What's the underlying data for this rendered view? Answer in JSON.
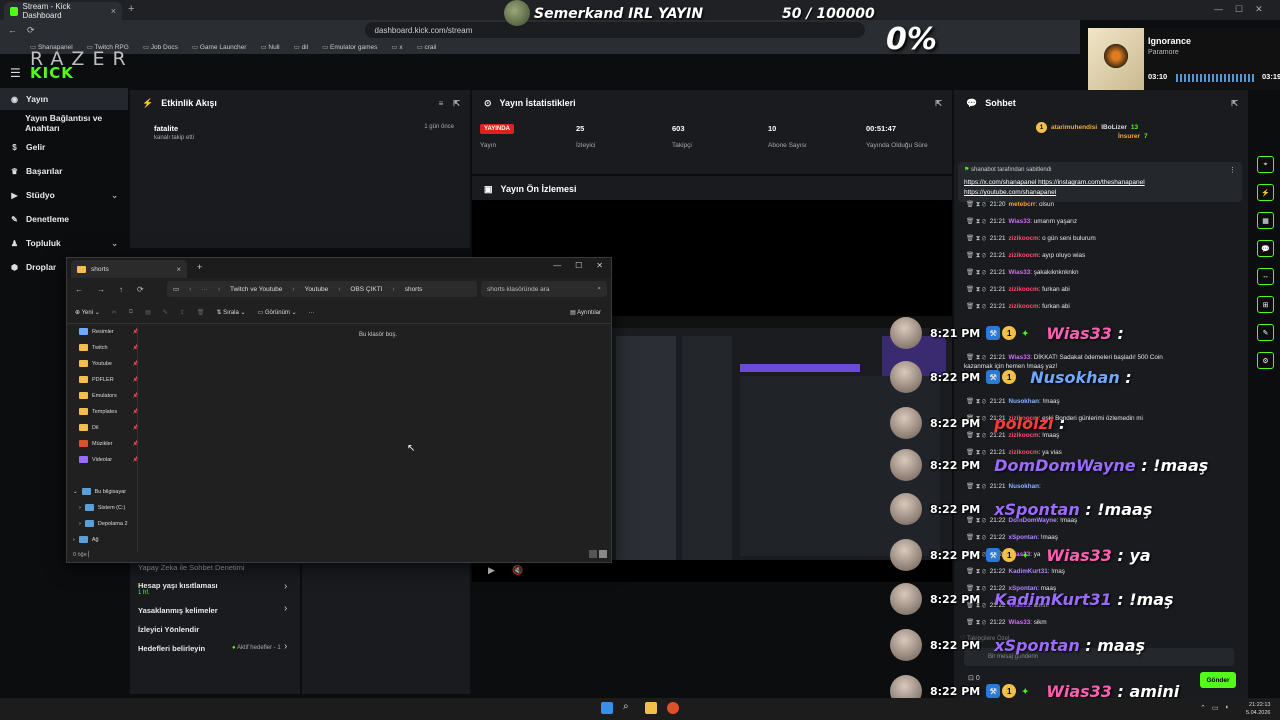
{
  "browser": {
    "tab_title": "Stream - Kick Dashboard",
    "url": "dashboard.kick.com/stream",
    "bookmarks": [
      "Shanapanel",
      "Twitch RPG",
      "Job Docs",
      "Game Launcher",
      "Null",
      "dil",
      "Emulator games",
      "x",
      "crail"
    ]
  },
  "overlay": {
    "stream_title": "Semerkand IRL YAYIN",
    "goal": "50 / 100000",
    "percent": "0%",
    "razer_logo": "RAZER"
  },
  "music": {
    "song": "Ignorance",
    "artist": "Paramore",
    "elapsed": "03:10",
    "remaining": "03:19"
  },
  "app": {
    "logo": "KICK",
    "sidebar": [
      {
        "label": "Yayın",
        "icon": "broadcast-icon",
        "active": true
      },
      {
        "label": "Yayın Bağlantısı ve Anahtarı",
        "icon": "",
        "active": false
      },
      {
        "label": "Gelir",
        "icon": "money-icon",
        "active": false
      },
      {
        "label": "Başarılar",
        "icon": "trophy-icon",
        "active": false
      },
      {
        "label": "Stüdyo",
        "icon": "studio-icon",
        "active": false,
        "chevron": true
      },
      {
        "label": "Denetleme",
        "icon": "wrench-icon",
        "active": false
      },
      {
        "label": "Topluluk",
        "icon": "community-icon",
        "active": false,
        "chevron": true
      },
      {
        "label": "Droplar",
        "icon": "drops-icon",
        "active": false
      }
    ]
  },
  "activity": {
    "title": "Etkinlik Akışı",
    "item": {
      "name": "fatalite",
      "text": "kanalı takip etti",
      "time": "1 gün önce"
    }
  },
  "stats": {
    "title": "Yayın İstatistikleri",
    "live_badge": "YAYINDA",
    "items": [
      {
        "value": "",
        "label": "Yayın"
      },
      {
        "value": "25",
        "label": "İzleyici"
      },
      {
        "value": "603",
        "label": "Takipçi"
      },
      {
        "value": "10",
        "label": "Abone Sayısı"
      },
      {
        "value": "00:51:47",
        "label": "Yayında Olduğu Süre"
      }
    ]
  },
  "preview": {
    "title": "Yayın Ön İzlemesi"
  },
  "settings": {
    "header": "Yapay Zeka ile Sohbet Denetimi",
    "items": [
      {
        "label": "Hesap yaşı kısıtlaması",
        "sub": "1 hf."
      },
      {
        "label": "Yasaklanmış kelimeler",
        "sub": ""
      },
      {
        "label": "İzleyici Yönlendir",
        "sub": ""
      },
      {
        "label": "Hedefleri belirleyin",
        "sub": "Aktif hedefler - 1"
      }
    ]
  },
  "explorer": {
    "tab": "shorts",
    "breadcrumbs": [
      "Twitch ve Youtube",
      "Youtube",
      "OBS ÇIKTI",
      "shorts"
    ],
    "search_placeholder": "shorts klasöründe ara",
    "cmd": {
      "new": "Yeni",
      "sort": "Sırala",
      "view": "Görünüm",
      "details": "Ayrıntılar"
    },
    "nav_items": [
      "Resimler",
      "Twitch",
      "Youtube",
      "PDFLER",
      "Emulators",
      "Templates",
      "Dil",
      "Müzikler",
      "Videolar"
    ],
    "tree": [
      "Bu bilgisayar",
      "Sistem (C:)",
      "Depolama 2",
      "Ağ"
    ],
    "empty_text": "Bu klasör boş.",
    "status": "0 öğe"
  },
  "chat": {
    "title": "Sohbet",
    "top_users": [
      {
        "name": "atarimuhendisi",
        "badge": "1"
      },
      {
        "name": "IBoLizer",
        "count": "13"
      },
      {
        "name": "İnsurer",
        "count": "7"
      }
    ],
    "pinned_by": "shanabot tarafından sabitlendi",
    "pinned_text": "https://x.com/shanapanel https://instagram.com/theshanapanel",
    "pinned_text2": "https://youtube.com/shanapanel",
    "lines": [
      {
        "time": "21:20",
        "user": "metebcrr",
        "msg": ": olsun",
        "color": "#f2a93b"
      },
      {
        "time": "21:21",
        "user": "Wias33",
        "msg": ": umarım yaşarız",
        "color": "#d36bff"
      },
      {
        "time": "21:21",
        "user": "zizikoocm",
        "msg": ": o gün seni bulurum",
        "color": "#ff4d6d"
      },
      {
        "time": "21:21",
        "user": "zizikoocm",
        "msg": ": ayıp oluyo wias",
        "color": "#ff4d6d"
      },
      {
        "time": "21:21",
        "user": "Wias33",
        "msg": ": şakakıknknknkn",
        "color": "#d36bff"
      },
      {
        "time": "21:21",
        "user": "zizikoocm",
        "msg": ": furkan abi",
        "color": "#ff4d6d"
      },
      {
        "time": "21:21",
        "user": "zizikoocm",
        "msg": ": furkan abi",
        "color": "#ff4d6d"
      },
      {
        "time": "21:21",
        "user": "Wias33",
        "msg": ": DİKKAT! Sadakat ödemeleri başladı! 500 Coin",
        "color": "#d36bff"
      },
      {
        "time": "",
        "user": "",
        "msg": "kazanmak için hemen !maaş yaz!",
        "color": "#ffffff"
      },
      {
        "time": "21:21",
        "user": "Nusokhan",
        "msg": ": !maaş",
        "color": "#8ab4ff"
      },
      {
        "time": "21:21",
        "user": "zizikoocm",
        "msg": ": eski Bonderi günlerimi özlemedin mi",
        "color": "#ff4d6d"
      },
      {
        "time": "21:21",
        "user": "zizikoocm",
        "msg": ": !maaş",
        "color": "#ff4d6d"
      },
      {
        "time": "21:21",
        "user": "zizikoocm",
        "msg": ": ya vias",
        "color": "#ff4d6d"
      },
      {
        "time": "21:21",
        "user": "Nusokhan",
        "msg": ": ",
        "color": "#8ab4ff"
      },
      {
        "time": "21:22",
        "user": "DomDomWayne",
        "msg": ": !maaş",
        "color": "#b084ff"
      },
      {
        "time": "21:22",
        "user": "xSpontan",
        "msg": ": !maaş",
        "color": "#b084ff"
      },
      {
        "time": "21:22",
        "user": "Wias33",
        "msg": ": ya",
        "color": "#d36bff"
      },
      {
        "time": "21:22",
        "user": "KadimKurt31",
        "msg": ": !maş",
        "color": "#b084ff"
      },
      {
        "time": "21:22",
        "user": "xSpontan",
        "msg": ": maaş",
        "color": "#b084ff"
      },
      {
        "time": "21:22",
        "user": "Wias33",
        "msg": ": amini",
        "color": "#d36bff"
      },
      {
        "time": "21:22",
        "user": "Wias33",
        "msg": ": sikm",
        "color": "#d36bff"
      }
    ],
    "input_placeholder": "Bir mesaj gönderin",
    "send_label": "Gönder",
    "counter": "0"
  },
  "overlay_chat": [
    {
      "time": "8:21 PM",
      "user": "Wias33",
      "msg": " :",
      "color": "#ff5fb0"
    },
    {
      "time": "8:22 PM",
      "user": "Nusokhan",
      "msg": " :",
      "color": "#6fa8ff"
    },
    {
      "time": "8:22 PM",
      "user": "pololzi",
      "msg": " :",
      "color": "#ff3b3b"
    },
    {
      "time": "8:22 PM",
      "user": "DomDomWayne",
      "msg": " : !maaş",
      "color": "#9b6bff"
    },
    {
      "time": "8:22 PM",
      "user": "xSpontan",
      "msg": " : !maaş",
      "color": "#9b6bff"
    },
    {
      "time": "8:22 PM",
      "user": "Wias33",
      "msg": " : ya",
      "color": "#ff5fb0"
    },
    {
      "time": "8:22 PM",
      "user": "KadimKurt31",
      "msg": " : !maş",
      "color": "#9b6bff"
    },
    {
      "time": "8:22 PM",
      "user": "xSpontan",
      "msg": " : maaş",
      "color": "#9b6bff"
    },
    {
      "time": "8:22 PM",
      "user": "Wias33",
      "msg": " : amini",
      "color": "#ff5fb0"
    }
  ],
  "taskbar": {
    "time": "21:22:13",
    "date": "5.04.2026"
  },
  "colors": {
    "kick_green": "#53fc18",
    "live_red": "#e02020"
  }
}
